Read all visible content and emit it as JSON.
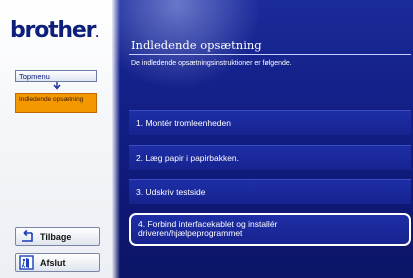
{
  "left": {
    "logo_text": "brother",
    "logo_suffix": ".",
    "nav": {
      "topmenu_label": "Topmenu",
      "current_label": "Indledende opsætning"
    },
    "buttons": {
      "back_label": "Tilbage",
      "exit_label": "Afslut"
    }
  },
  "main": {
    "title": "Indledende opsætning",
    "intro": "De indledende opsætningsinstruktioner er følgende.",
    "steps": [
      {
        "label": "1. Montér tromleenheden"
      },
      {
        "label": "2. Læg papir i papirbakken."
      },
      {
        "label": "3. Udskriv testside"
      },
      {
        "label": "4. Forbind interfacekablet og installér\ndriveren/hjælpeprogrammet"
      }
    ]
  },
  "icons": {
    "back": "back-arrow-icon",
    "exit": "exit-door-icon",
    "nav_arrow": "down-arrow-icon"
  },
  "colors": {
    "brand": "#0d1f7a",
    "panel": "#14218a",
    "highlight": "#f39800"
  }
}
